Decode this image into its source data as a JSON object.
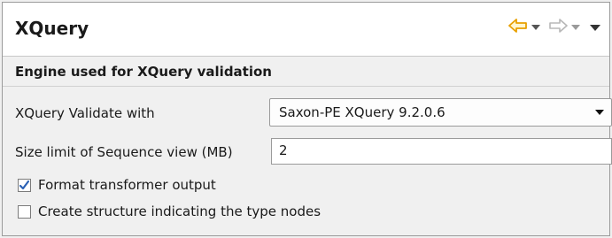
{
  "panel": {
    "title": "XQuery"
  },
  "nav": {
    "back_icon": "back-arrow-icon",
    "forward_icon": "forward-arrow-icon",
    "menu_icon": "view-menu-icon"
  },
  "section": {
    "title": "Engine used for XQuery validation"
  },
  "validate": {
    "label": "XQuery Validate with",
    "selected": "Saxon-PE XQuery 9.2.0.6"
  },
  "sequence_limit": {
    "label": "Size limit of Sequence view (MB)",
    "value": "2"
  },
  "options": {
    "format_output": {
      "label": "Format transformer output",
      "checked": true
    },
    "structure_nodes": {
      "label": "Create structure indicating the type nodes",
      "checked": false
    }
  },
  "colors": {
    "accent_orange": "#e8a000",
    "check_blue": "#2b61b5"
  }
}
